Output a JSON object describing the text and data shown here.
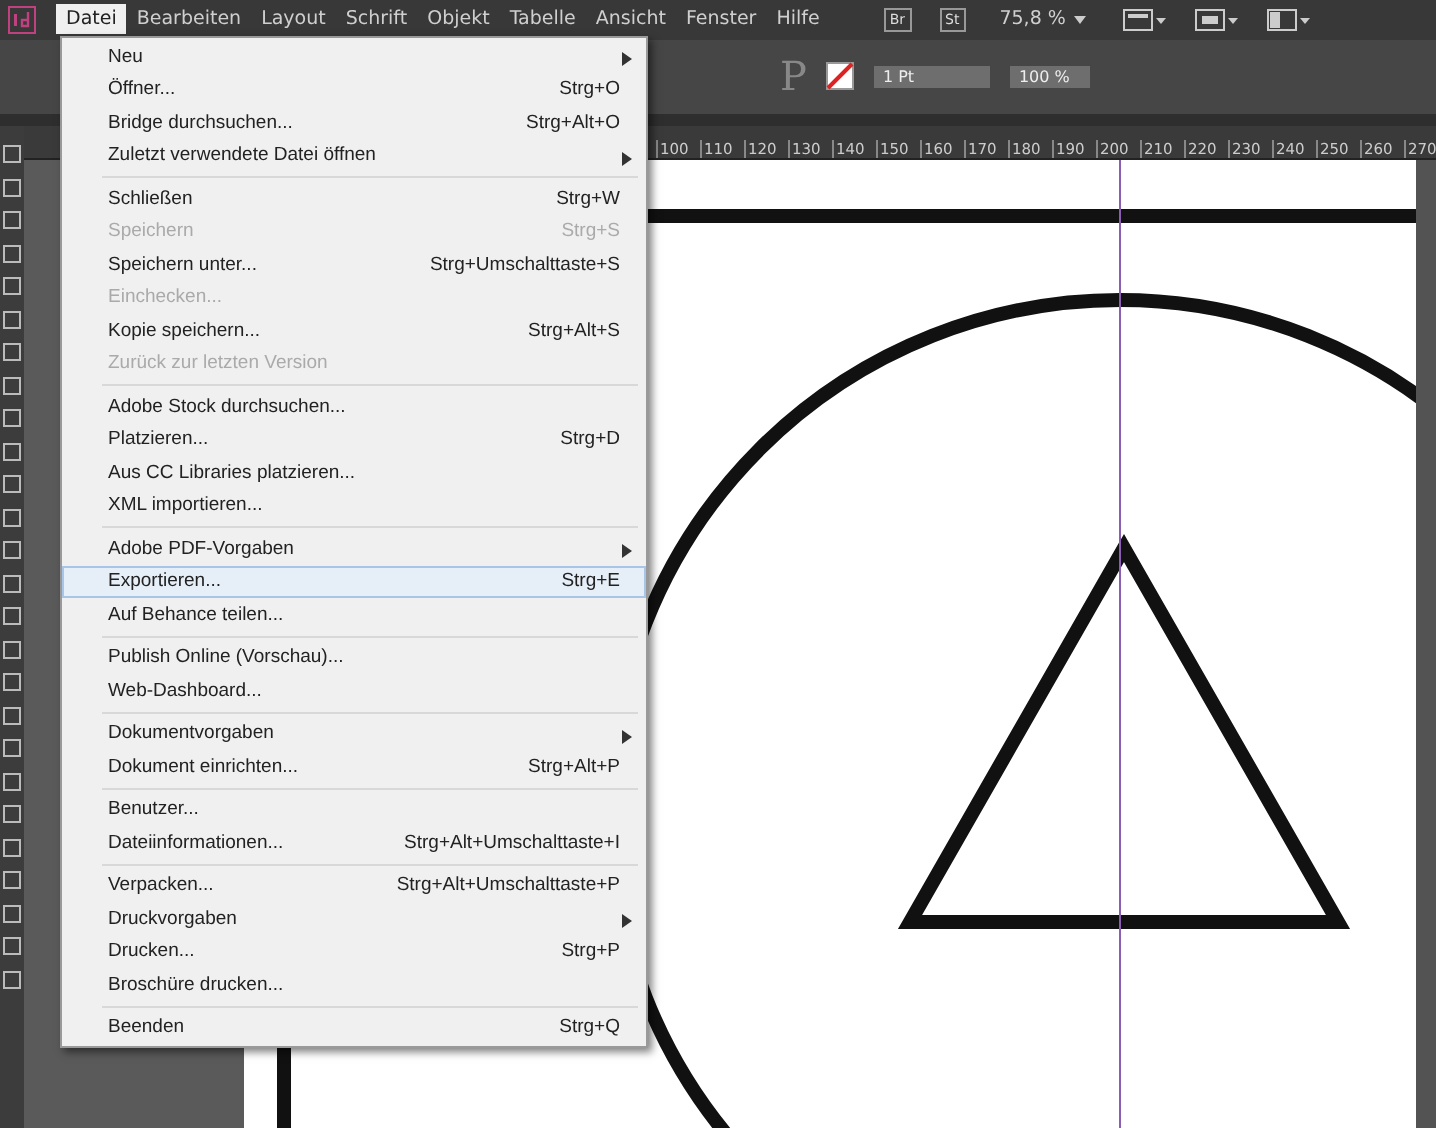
{
  "menubar": {
    "items": [
      {
        "label": "Datei",
        "selected": true
      },
      {
        "label": "Bearbeiten",
        "selected": false
      },
      {
        "label": "Layout",
        "selected": false
      },
      {
        "label": "Schrift",
        "selected": false
      },
      {
        "label": "Objekt",
        "selected": false
      },
      {
        "label": "Tabelle",
        "selected": false
      },
      {
        "label": "Ansicht",
        "selected": false
      },
      {
        "label": "Fenster",
        "selected": false
      },
      {
        "label": "Hilfe",
        "selected": false
      }
    ],
    "app_badges": [
      "Br",
      "St"
    ],
    "zoom": "75,8 %"
  },
  "control_bar": {
    "paragraph_glyph": "P",
    "stroke_weight": "1 Pt",
    "opacity": "100 %"
  },
  "ruler": {
    "labels": [
      "100",
      "110",
      "120",
      "130",
      "140",
      "150",
      "160",
      "170",
      "180",
      "190",
      "200",
      "210",
      "220",
      "230",
      "240",
      "250",
      "260",
      "270"
    ]
  },
  "file_menu": {
    "groups": [
      [
        {
          "label": "Neu",
          "submenu": true,
          "disabled": false,
          "selected": false
        },
        {
          "label": "Öffner...",
          "shortcut": "Strg+O",
          "submenu": false,
          "disabled": false,
          "selected": false
        },
        {
          "label": "Bridge durchsuchen...",
          "shortcut": "Strg+Alt+O",
          "submenu": false,
          "disabled": false,
          "selected": false
        },
        {
          "label": "Zuletzt verwendete Datei öffnen",
          "submenu": true,
          "disabled": false,
          "selected": false
        }
      ],
      [
        {
          "label": "Schließen",
          "shortcut": "Strg+W",
          "submenu": false,
          "disabled": false,
          "selected": false
        },
        {
          "label": "Speichern",
          "shortcut": "Strg+S",
          "submenu": false,
          "disabled": true,
          "selected": false
        },
        {
          "label": "Speichern unter...",
          "shortcut": "Strg+Umschalttaste+S",
          "submenu": false,
          "disabled": false,
          "selected": false
        },
        {
          "label": "Einchecken...",
          "submenu": false,
          "disabled": true,
          "selected": false
        },
        {
          "label": "Kopie speichern...",
          "shortcut": "Strg+Alt+S",
          "submenu": false,
          "disabled": false,
          "selected": false
        },
        {
          "label": "Zurück zur letzten Version",
          "submenu": false,
          "disabled": true,
          "selected": false
        }
      ],
      [
        {
          "label": "Adobe Stock durchsuchen...",
          "submenu": false,
          "disabled": false,
          "selected": false
        },
        {
          "label": "Platzieren...",
          "shortcut": "Strg+D",
          "submenu": false,
          "disabled": false,
          "selected": false
        },
        {
          "label": "Aus CC Libraries platzieren...",
          "submenu": false,
          "disabled": false,
          "selected": false
        },
        {
          "label": "XML importieren...",
          "submenu": false,
          "disabled": false,
          "selected": false
        }
      ],
      [
        {
          "label": "Adobe PDF-Vorgaben",
          "submenu": true,
          "disabled": false,
          "selected": false
        },
        {
          "label": "Exportieren...",
          "shortcut": "Strg+E",
          "submenu": false,
          "disabled": false,
          "selected": true
        },
        {
          "label": "Auf Behance teilen...",
          "submenu": false,
          "disabled": false,
          "selected": false
        }
      ],
      [
        {
          "label": "Publish Online (Vorschau)...",
          "submenu": false,
          "disabled": false,
          "selected": false
        },
        {
          "label": "Web-Dashboard...",
          "submenu": false,
          "disabled": false,
          "selected": false
        }
      ],
      [
        {
          "label": "Dokumentvorgaben",
          "submenu": true,
          "disabled": false,
          "selected": false
        },
        {
          "label": "Dokument einrichten...",
          "shortcut": "Strg+Alt+P",
          "submenu": false,
          "disabled": false,
          "selected": false
        }
      ],
      [
        {
          "label": "Benutzer...",
          "submenu": false,
          "disabled": false,
          "selected": false
        },
        {
          "label": "Dateiinformationen...",
          "shortcut": "Strg+Alt+Umschalttaste+I",
          "submenu": false,
          "disabled": false,
          "selected": false
        }
      ],
      [
        {
          "label": "Verpacken...",
          "shortcut": "Strg+Alt+Umschalttaste+P",
          "submenu": false,
          "disabled": false,
          "selected": false
        },
        {
          "label": "Druckvorgaben",
          "submenu": true,
          "disabled": false,
          "selected": false
        },
        {
          "label": "Drucken...",
          "shortcut": "Strg+P",
          "submenu": false,
          "disabled": false,
          "selected": false
        },
        {
          "label": "Broschüre drucken...",
          "submenu": false,
          "disabled": false,
          "selected": false
        }
      ],
      [
        {
          "label": "Beenden",
          "shortcut": "Strg+Q",
          "submenu": false,
          "disabled": false,
          "selected": false
        }
      ]
    ]
  }
}
